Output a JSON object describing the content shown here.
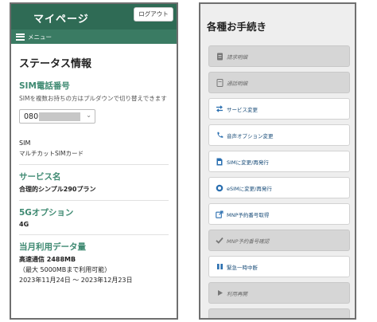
{
  "left_panel": {
    "header": {
      "title": "マイページ",
      "logout_label": "ログアウト",
      "menu_label": "メニュー"
    },
    "status_heading": "ステータス情報",
    "sim_number": {
      "title": "SIM電話番号",
      "note": "SIMを複数お持ちの方はプルダウンで切り替えできます",
      "selected_prefix": "080"
    },
    "sim_type": {
      "label": "SIM",
      "value": "マルチカットSIMカード"
    },
    "service": {
      "title": "サービス名",
      "value": "合理的シンプル290プラン"
    },
    "option_5g": {
      "title": "5Gオプション",
      "value": "4G"
    },
    "data_usage": {
      "title": "当月利用データ量",
      "high_speed": "高速通信 2488MB",
      "limit": "（最大 5000MBまで利用可能）",
      "period": "2023年11月24日 ～ 2023年12月23日"
    }
  },
  "right_panel": {
    "title": "各種お手続き",
    "buttons": [
      {
        "label": "請求明細",
        "icon": "document-icon",
        "disabled": true
      },
      {
        "label": "通話明細",
        "icon": "note-icon",
        "disabled": true
      },
      {
        "label": "サービス変更",
        "icon": "swap-icon",
        "disabled": false
      },
      {
        "label": "音声オプション変更",
        "icon": "phone-icon",
        "disabled": false
      },
      {
        "label": "SIMに変更/再発行",
        "icon": "sim-card-icon",
        "disabled": false
      },
      {
        "label": "eSIMに変更/再発行",
        "icon": "esim-icon",
        "disabled": false
      },
      {
        "label": "MNP予約番号取得",
        "icon": "external-link-icon",
        "disabled": false
      },
      {
        "label": "MNP予約番号確認",
        "icon": "check-icon",
        "disabled": true
      },
      {
        "label": "緊急一時中断",
        "icon": "pause-icon",
        "disabled": false
      },
      {
        "label": "利用再開",
        "icon": "play-icon",
        "disabled": true
      }
    ]
  },
  "colors": {
    "header_bg": "#2f6b55",
    "menu_bg": "#3a7b63",
    "section_title": "#3f8a72",
    "link_text": "#1b4e7a",
    "disabled_bg": "#d6d6d6",
    "right_bg": "#eeeeee"
  }
}
